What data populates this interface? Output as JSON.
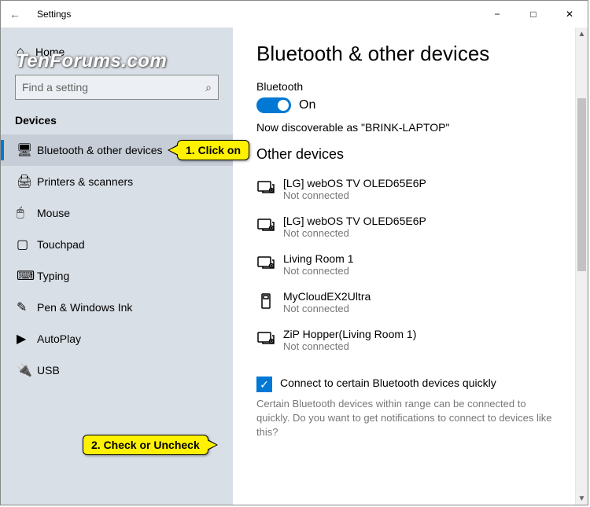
{
  "window": {
    "title": "Settings"
  },
  "sidebar": {
    "home": "Home",
    "search_placeholder": "Find a setting",
    "section": "Devices",
    "items": [
      {
        "label": "Bluetooth & other devices"
      },
      {
        "label": "Printers & scanners"
      },
      {
        "label": "Mouse"
      },
      {
        "label": "Touchpad"
      },
      {
        "label": "Typing"
      },
      {
        "label": "Pen & Windows Ink"
      },
      {
        "label": "AutoPlay"
      },
      {
        "label": "USB"
      }
    ]
  },
  "main": {
    "title": "Bluetooth & other devices",
    "bt_label": "Bluetooth",
    "bt_state": "On",
    "discoverable": "Now discoverable as \"BRINK-LAPTOP\"",
    "other_heading": "Other devices",
    "devices": [
      {
        "name": "[LG] webOS TV OLED65E6P",
        "status": "Not connected"
      },
      {
        "name": "[LG] webOS TV OLED65E6P",
        "status": "Not connected"
      },
      {
        "name": "Living Room 1",
        "status": "Not connected"
      },
      {
        "name": "MyCloudEX2Ultra",
        "status": "Not connected"
      },
      {
        "name": "ZiP Hopper(Living Room 1)",
        "status": "Not connected"
      }
    ],
    "quick_label": "Connect to certain Bluetooth devices quickly",
    "quick_desc": "Certain Bluetooth devices within range can be connected to quickly. Do you want to get notifications to connect to devices like this?"
  },
  "callouts": {
    "one": "1. Click on",
    "two": "2. Check or Uncheck"
  },
  "watermark": "TenForums.com"
}
